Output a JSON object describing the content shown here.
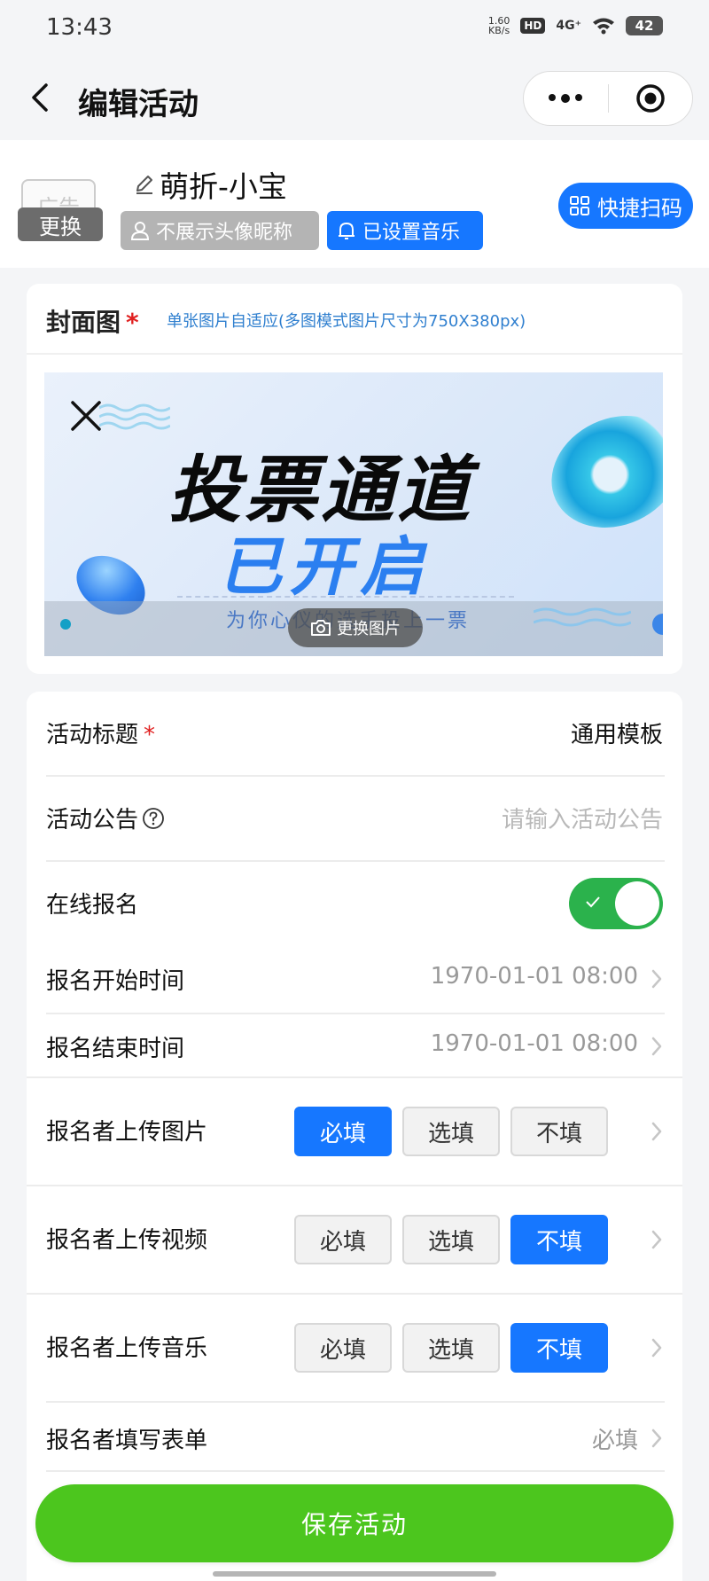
{
  "status_bar": {
    "time": "13:43",
    "net_speed_value": "1.60",
    "net_speed_unit": "KB/s",
    "hd": "HD",
    "signal": "4G⁺",
    "battery": "42"
  },
  "nav": {
    "title": "编辑活动"
  },
  "profile": {
    "ad_placeholder": "广告",
    "change_label": "更换",
    "name": "萌折-小宝",
    "tag_avatar": "不展示头像昵称",
    "tag_music": "已设置音乐",
    "quick_scan": "快捷扫码"
  },
  "cover": {
    "label": "封面图",
    "required_mark": "*",
    "hint": "单张图片自适应(多图模式图片尺寸为750X380px)",
    "banner_title": "投票通道",
    "banner_subtitle": "已开启",
    "banner_tagline": "为你心仪的选手投上一票",
    "change_image": "更换图片"
  },
  "form": {
    "title_label": "活动标题",
    "title_required": "*",
    "title_value": "通用模板",
    "notice_label": "活动公告",
    "notice_placeholder": "请输入活动公告",
    "online_signup_label": "在线报名",
    "online_signup_enabled": true,
    "start_time_label": "报名开始时间",
    "start_time_value": "1970-01-01 08:00",
    "end_time_label": "报名结束时间",
    "end_time_value": "1970-01-01 08:00",
    "upload_image_label": "报名者上传图片",
    "upload_video_label": "报名者上传视频",
    "upload_music_label": "报名者上传音乐",
    "option_required": "必填",
    "option_optional": "选填",
    "option_none": "不填",
    "upload_image_selected": "必填",
    "upload_video_selected": "不填",
    "upload_music_selected": "不填",
    "form_fill_label": "报名者填写表单",
    "form_fill_value": "必填"
  },
  "actions": {
    "save": "保存活动"
  },
  "colors": {
    "primary": "#1677ff",
    "save": "#4cc61e",
    "toggle_on": "#2bb24c",
    "required": "#e02020"
  }
}
